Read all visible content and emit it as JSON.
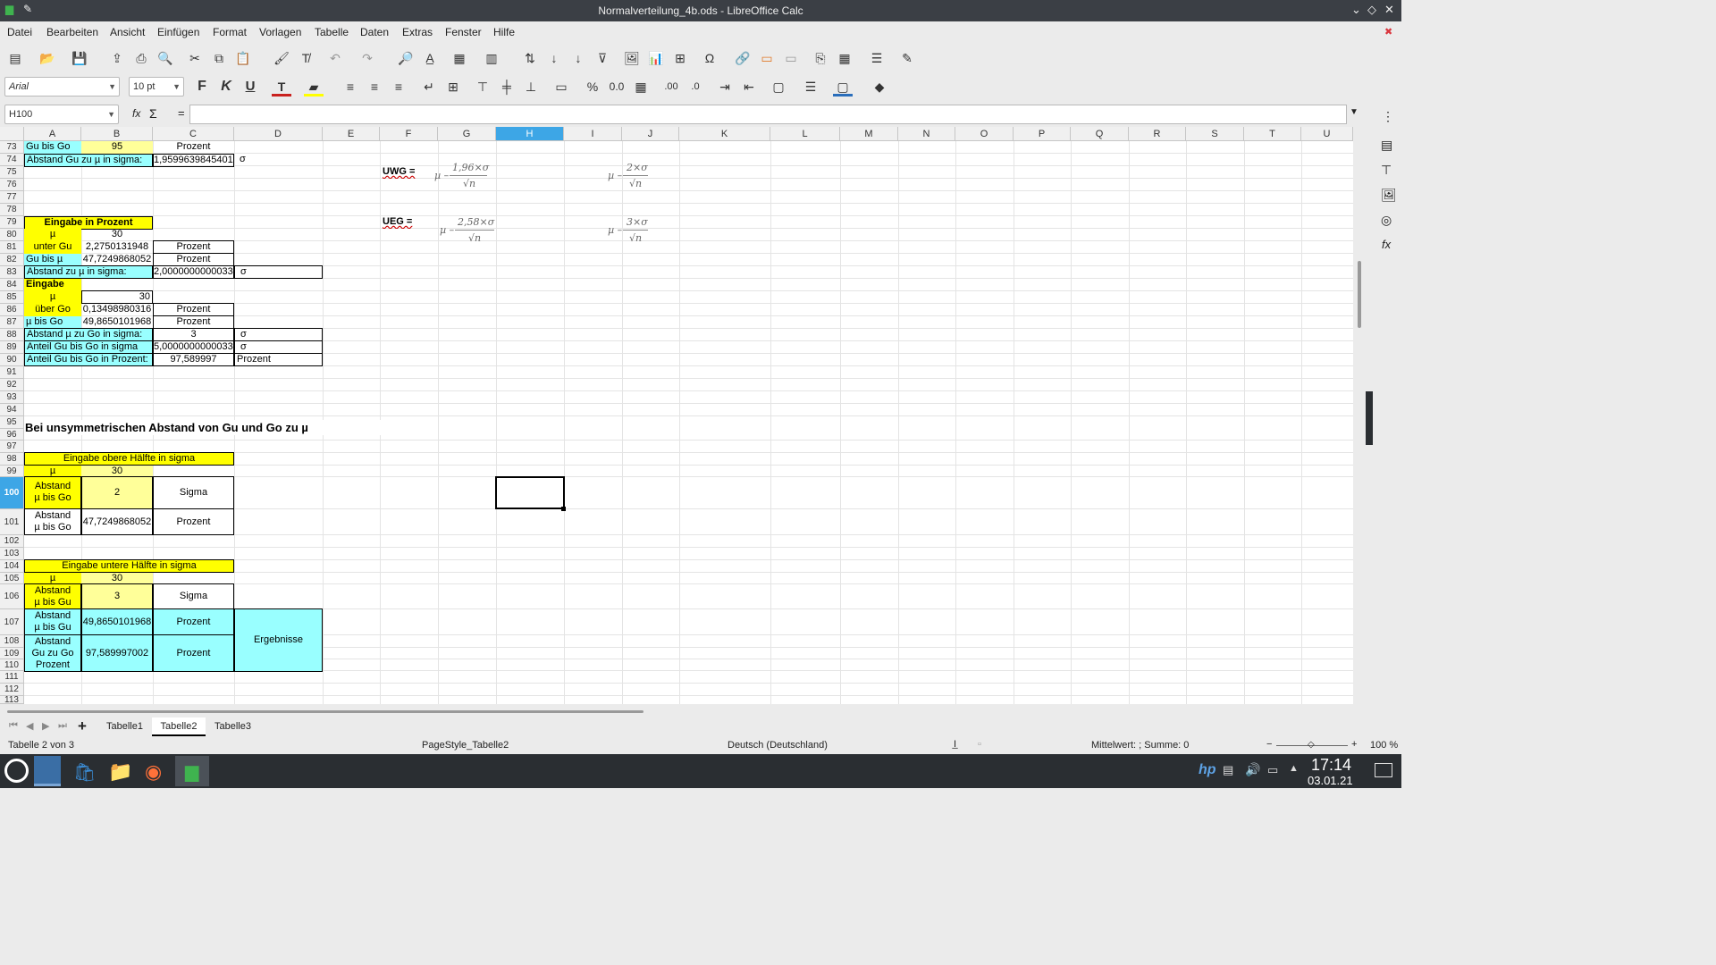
{
  "window": {
    "title": "Normalverteilung_4b.ods - LibreOffice Calc"
  },
  "menu": [
    "Datei",
    "Bearbeiten",
    "Ansicht",
    "Einfügen",
    "Format",
    "Vorlagen",
    "Tabelle",
    "Daten",
    "Extras",
    "Fenster",
    "Hilfe"
  ],
  "format_bar": {
    "font": "Arial",
    "size": "10 pt"
  },
  "formula_bar": {
    "name_box": "H100",
    "fx": "fx",
    "sigma": "Σ",
    "equals": "="
  },
  "columns": [
    "A",
    "B",
    "C",
    "D",
    "E",
    "F",
    "G",
    "H",
    "I",
    "J",
    "K",
    "L",
    "M",
    "N",
    "O",
    "P",
    "Q",
    "R",
    "S",
    "T",
    "U"
  ],
  "rows": [
    "73",
    "74",
    "75",
    "76",
    "77",
    "78",
    "79",
    "80",
    "81",
    "82",
    "83",
    "84",
    "85",
    "86",
    "87",
    "88",
    "89",
    "90",
    "91",
    "92",
    "93",
    "94",
    "95",
    "96",
    "97",
    "98",
    "99",
    "100",
    "101",
    "102",
    "103",
    "104",
    "105",
    "106",
    "107",
    "108",
    "109",
    "110",
    "111",
    "112",
    "113"
  ],
  "cells": {
    "a73": "Gu bis Go",
    "b73": "95",
    "c73": "Prozent",
    "a74": "Abstand Gu zu µ in sigma:",
    "c74": "1,9599639845401",
    "d74": "σ",
    "f75": "UWG =",
    "f79": "UEG =",
    "a79": "Eingabe in Prozent",
    "a80": "µ",
    "b80": "30",
    "a81": "unter Gu",
    "b81": "2,2750131948",
    "c81": "Prozent",
    "a82": "Gu bis µ",
    "b82": "47,7249868052",
    "c82": "Prozent",
    "a83": "Abstand zu µ in sigma:",
    "c83": "2,0000000000033",
    "d83": "σ",
    "a84": "Eingabe",
    "a85": "µ",
    "b85": "30",
    "a86": "über Go",
    "b86": "0,13498980316",
    "c86": "Prozent",
    "a87": "µ bis Go",
    "b87": "49,8650101968",
    "c87": "Prozent",
    "a88": "Abstand µ zu Go in sigma:",
    "c88": "3",
    "d88": "σ",
    "a89": "Anteil Gu bis Go in sigma",
    "c89": "5,0000000000033",
    "d89": "σ",
    "a90": "Anteil Gu bis Go in Prozent:",
    "c90": "97,589997",
    "d90": "Prozent",
    "a95": "Bei unsymmetrischen Abstand von Gu und Go zu µ",
    "a98": "Eingabe obere Hälfte in sigma",
    "a99": "µ",
    "b99": "30",
    "a100": "Abstand\nµ bis Go",
    "b100": "2",
    "c100": "Sigma",
    "a101": "Abstand\nµ bis Go",
    "b101": "47,7249868052",
    "c101": "Prozent",
    "a104": "Eingabe untere Hälfte in sigma",
    "a105": "µ",
    "b105": "30",
    "a106": "Abstand\nµ bis Gu",
    "b106": "3",
    "c106": "Sigma",
    "a107": "Abstand\nµ bis Gu",
    "b107": "49,8650101968",
    "c107": "Prozent",
    "a108": "Abstand\nGu zu Go\nProzent",
    "b108": "97,589997002",
    "c108": "Prozent",
    "d107": "Ergebnisse"
  },
  "formulas": {
    "g75_num": "1,96×σ",
    "g75_mu": "µ –",
    "g75_den": "√n",
    "j75_num": "2×σ",
    "j75_mu": "µ –",
    "j75_den": "√n",
    "g79_num": "2,58×σ",
    "g79_mu": "µ –",
    "g79_den": "√n",
    "j79_num": "3×σ",
    "j79_mu": "µ –",
    "j79_den": "√n"
  },
  "sheets": [
    "Tabelle1",
    "Tabelle2",
    "Tabelle3"
  ],
  "active_sheet": "Tabelle2",
  "status": {
    "sheet": "Tabelle 2 von 3",
    "style": "PageStyle_Tabelle2",
    "language": "Deutsch (Deutschland)",
    "sum": "Mittelwert: ; Summe: 0",
    "zoom": "100 %"
  },
  "taskbar": {
    "time": "17:14",
    "date": "03.01.21"
  }
}
